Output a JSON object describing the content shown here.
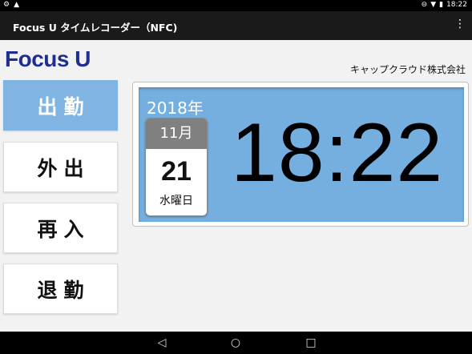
{
  "status_bar": {
    "time": "18:22"
  },
  "app_bar": {
    "title": "Focus U タイムレコーダー（NFC)",
    "menu_icon": "⋮"
  },
  "logo": {
    "text": "Focus U",
    "color": "#1f2f8f"
  },
  "company_name": "キャップクラウド株式会社",
  "buttons": [
    {
      "label": "出勤",
      "active": true
    },
    {
      "label": "外出",
      "active": false
    },
    {
      "label": "再入",
      "active": false
    },
    {
      "label": "退勤",
      "active": false
    }
  ],
  "clock": {
    "year": "2018年",
    "month": "11月",
    "day": "21",
    "weekday": "水曜日",
    "time": "18:22"
  },
  "colors": {
    "accent": "#7fb4e3",
    "clock_bg": "#74afe0"
  }
}
